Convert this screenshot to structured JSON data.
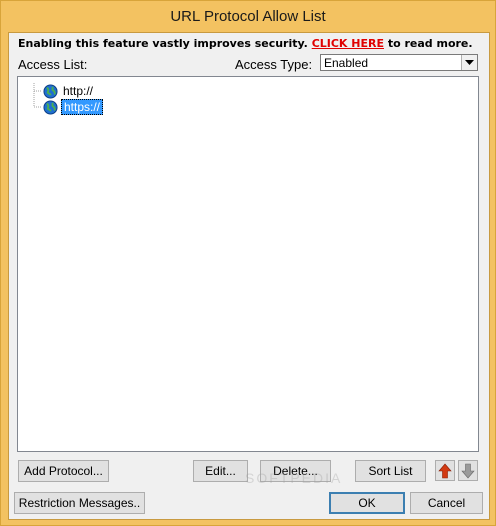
{
  "window": {
    "title": "URL Protocol Allow List"
  },
  "notice": {
    "prefix": "Enabling this feature vastly improves security. ",
    "link": "CLICK HERE",
    "suffix": " to read more."
  },
  "access_list": {
    "label": "Access List:"
  },
  "access_type": {
    "label": "Access Type:",
    "value": "Enabled"
  },
  "tree": {
    "items": [
      {
        "label": "http://",
        "selected": false,
        "icon": "globe-icon"
      },
      {
        "label": "https://",
        "selected": true,
        "icon": "globe-icon"
      }
    ]
  },
  "buttons": {
    "add_protocol": "Add Protocol...",
    "edit": "Edit...",
    "delete": "Delete...",
    "sort_list": "Sort List",
    "restriction_messages": "Restriction Messages..",
    "ok": "OK",
    "cancel": "Cancel"
  },
  "arrows": {
    "up_icon": "arrow-up-icon",
    "down_icon": "arrow-down-icon",
    "up_color": "#d23a12",
    "down_color": "#9a9a9a"
  },
  "watermark": "SOFTPEDIA"
}
